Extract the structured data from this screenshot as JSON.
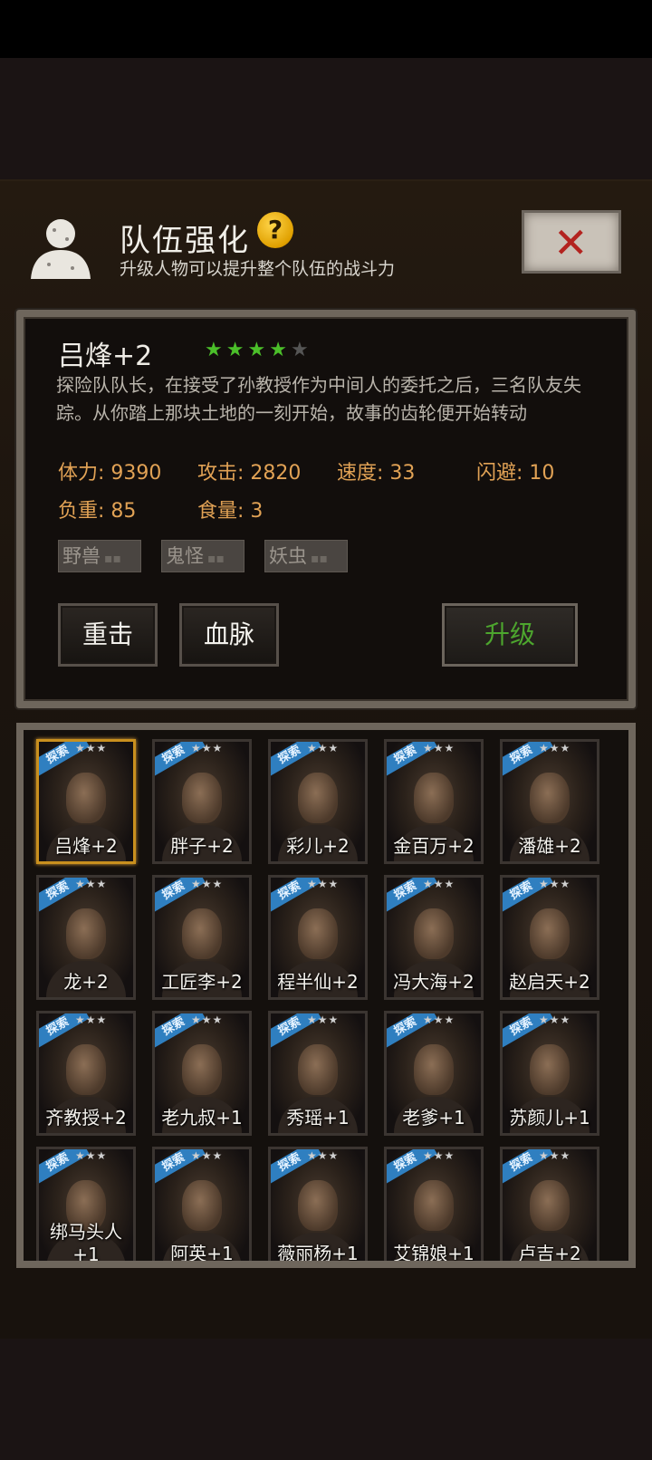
{
  "header": {
    "title": "队伍强化",
    "help_icon": "?",
    "subtitle": "升级人物可以提升整个队伍的战斗力",
    "close_icon": "✕"
  },
  "detail": {
    "name": "吕烽+2",
    "stars_filled": 4,
    "stars_total": 5,
    "description": "探险队队长，在接受了孙教授作为中间人的委托之后，三名队友失踪。从你踏上那块土地的一刻开始，故事的齿轮便开始转动",
    "stats": {
      "hp": "体力: 9390",
      "attack": "攻击: 2820",
      "speed": "速度: 33",
      "dodge": "闪避: 10",
      "load": "负重: 85",
      "food": "食量: 3"
    },
    "tags": [
      "野兽",
      "鬼怪",
      "妖虫"
    ],
    "tag_suffix": "▪▪",
    "buttons": {
      "heavy_strike": "重击",
      "bloodline": "血脉",
      "upgrade": "升级"
    }
  },
  "roster": {
    "badge_label": "探索",
    "rank_stars": "★★★",
    "cards": [
      {
        "name": "吕烽+2"
      },
      {
        "name": "胖子+2"
      },
      {
        "name": "彩儿+2"
      },
      {
        "name": "金百万+2"
      },
      {
        "name": "潘雄+2"
      },
      {
        "name": "龙+2"
      },
      {
        "name": "工匠李+2"
      },
      {
        "name": "程半仙+2"
      },
      {
        "name": "冯大海+2"
      },
      {
        "name": "赵启天+2"
      },
      {
        "name": "齐教授+2"
      },
      {
        "name": "老九叔+1"
      },
      {
        "name": "秀瑶+1"
      },
      {
        "name": "老爹+1"
      },
      {
        "name": "苏颜儿+1"
      },
      {
        "name": "绑马头人+1"
      },
      {
        "name": "阿英+1"
      },
      {
        "name": "薇丽杨+1"
      },
      {
        "name": "艾锦娘+1"
      },
      {
        "name": "卢吉+2"
      }
    ],
    "selected_index": 0
  },
  "colors": {
    "accent_star": "#4bbf2a",
    "stat_text": "#e1a255",
    "upgrade_text": "#4da62e",
    "badge": "#2f7fc0",
    "selected_border": "#c9901e"
  }
}
